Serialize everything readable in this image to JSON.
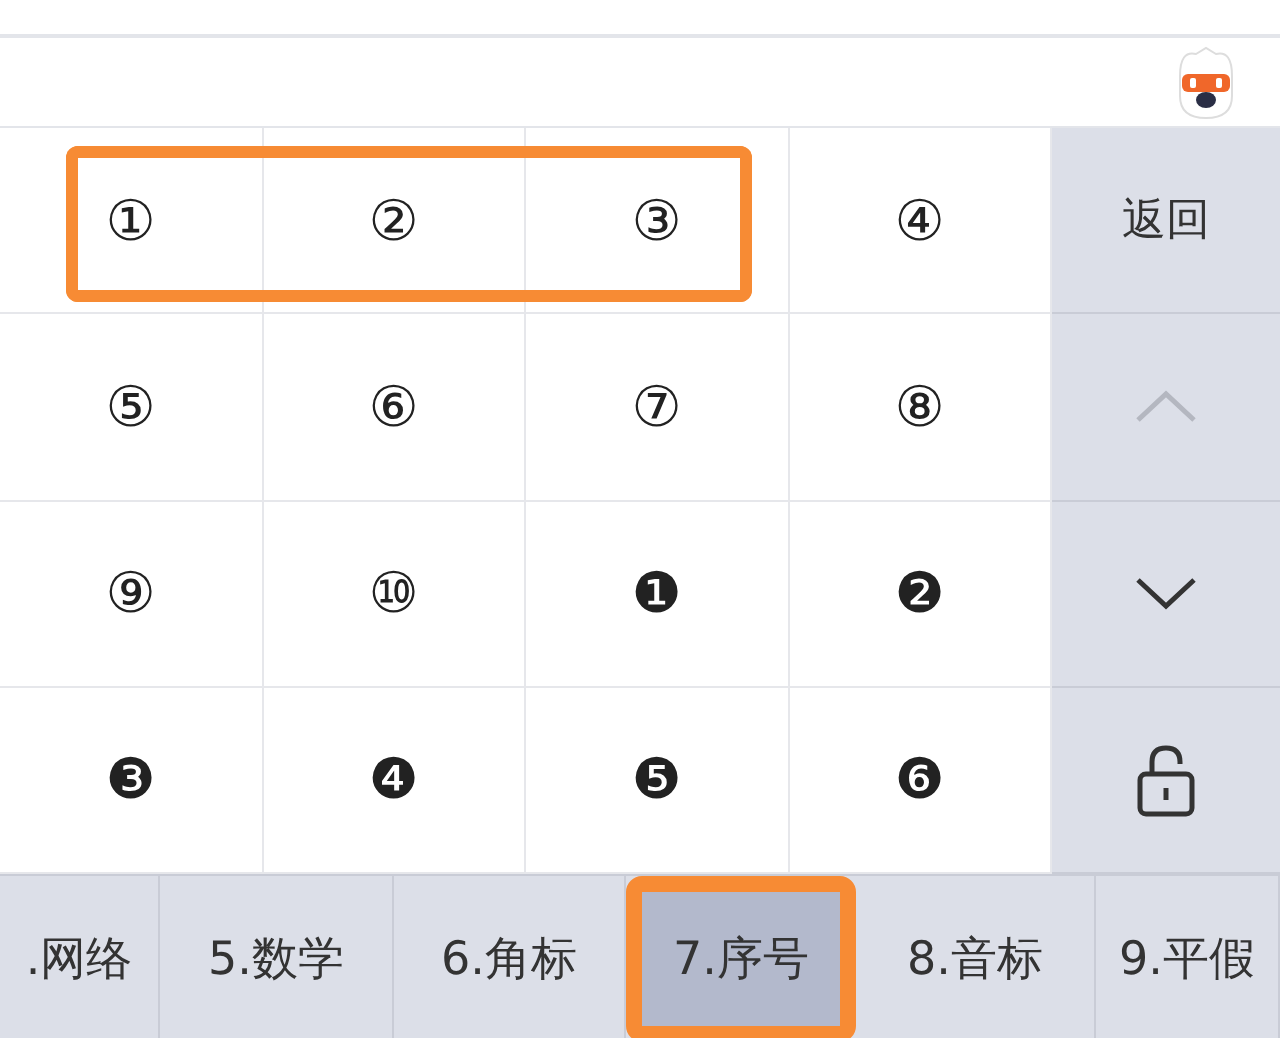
{
  "keys": [
    {
      "label": "①",
      "highlighted": true
    },
    {
      "label": "②",
      "highlighted": true
    },
    {
      "label": "③",
      "highlighted": true
    },
    {
      "label": "④",
      "highlighted": false
    },
    {
      "label": "⑤",
      "highlighted": false
    },
    {
      "label": "⑥",
      "highlighted": false
    },
    {
      "label": "⑦",
      "highlighted": false
    },
    {
      "label": "⑧",
      "highlighted": false
    },
    {
      "label": "⑨",
      "highlighted": false
    },
    {
      "label": "⑩",
      "highlighted": false
    },
    {
      "label": "❶",
      "highlighted": false
    },
    {
      "label": "❷",
      "highlighted": false
    },
    {
      "label": "❸",
      "highlighted": false
    },
    {
      "label": "❹",
      "highlighted": false
    },
    {
      "label": "❺",
      "highlighted": false
    },
    {
      "label": "❻",
      "highlighted": false
    }
  ],
  "side_keys": [
    {
      "kind": "text",
      "label": "返回",
      "disabled": false
    },
    {
      "kind": "up",
      "disabled": true
    },
    {
      "kind": "down",
      "disabled": false
    },
    {
      "kind": "lock",
      "disabled": false
    }
  ],
  "categories": [
    {
      "label": ".网络",
      "selected": false,
      "highlighted": false
    },
    {
      "label": "5.数学",
      "selected": false,
      "highlighted": false
    },
    {
      "label": "6.角标",
      "selected": false,
      "highlighted": false
    },
    {
      "label": "7.序号",
      "selected": true,
      "highlighted": true
    },
    {
      "label": "8.音标",
      "selected": false,
      "highlighted": false
    },
    {
      "label": "9.平假",
      "selected": false,
      "highlighted": false
    }
  ]
}
